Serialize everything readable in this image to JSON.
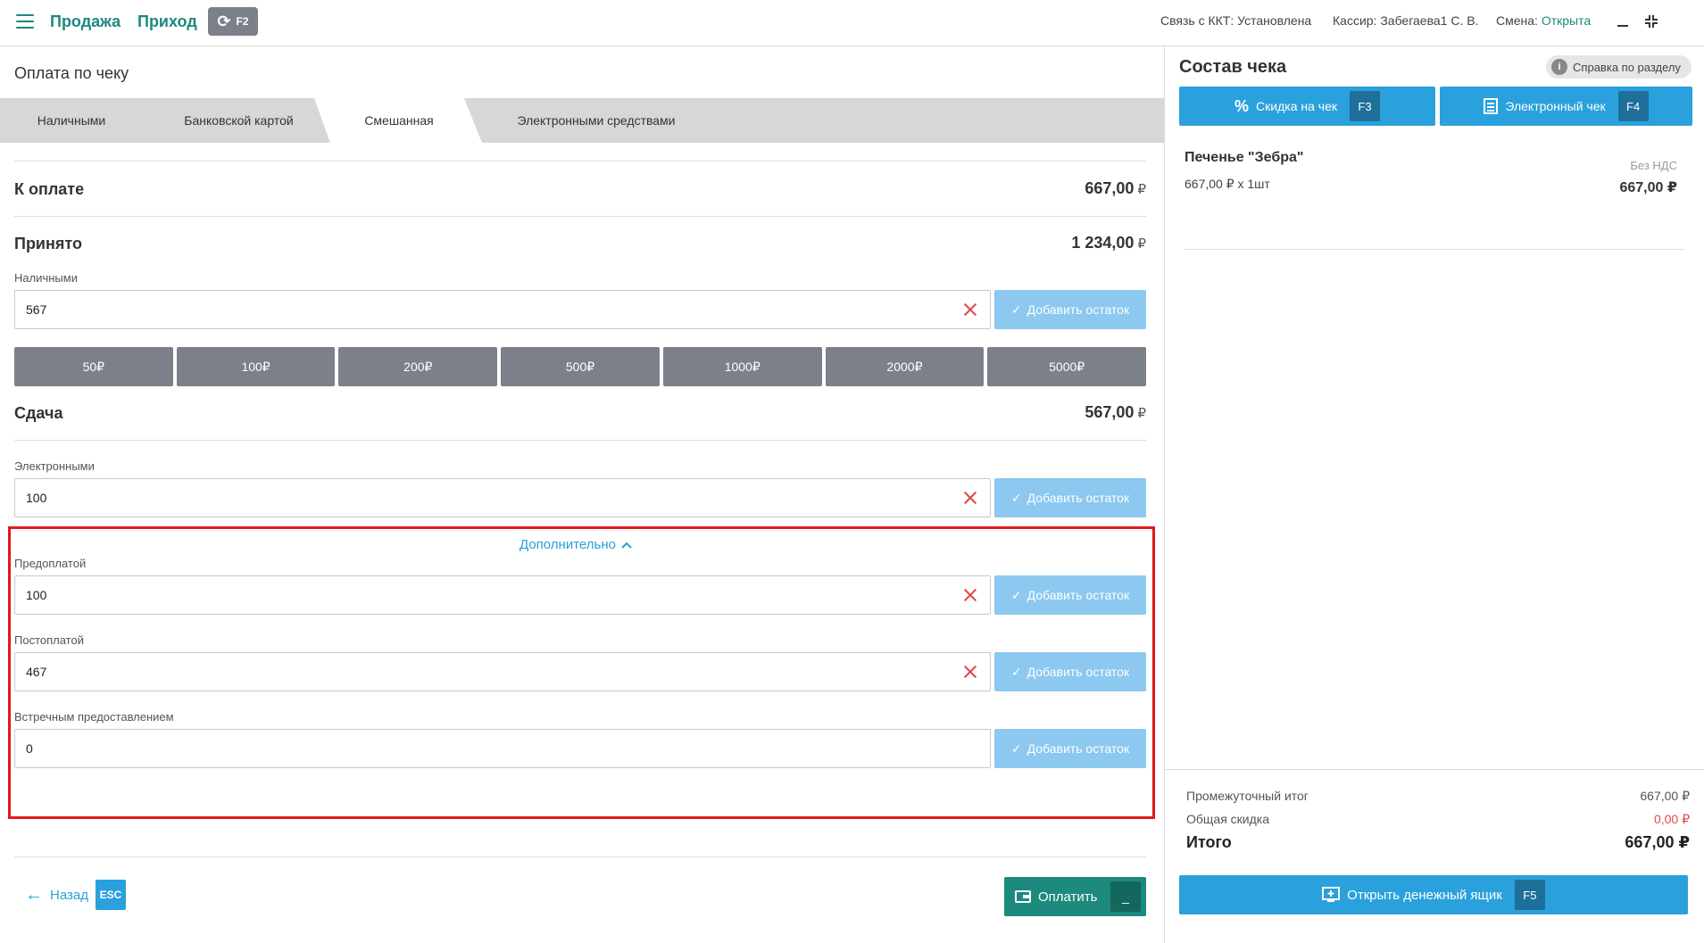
{
  "header": {
    "mode_sale": "Продажа",
    "mode_income": "Приход",
    "sync_key": "F2",
    "kkt_label": "Связь с ККТ: Установлена",
    "cashier_label": "Кассир: Забегаева1 С. В.",
    "shift_label": "Смена:",
    "shift_value": "Открыта"
  },
  "left": {
    "page_title": "Оплата по чеку",
    "tabs": [
      "Наличными",
      "Банковской картой",
      "Смешанная",
      "Электронными средствами"
    ],
    "active_tab": "Смешанная",
    "to_pay_label": "К оплате",
    "to_pay_value": "667,00",
    "received_label": "Принято",
    "received_value": "1 234,00",
    "currency": "₽",
    "cash_label": "Наличными",
    "cash_value": "567",
    "add_rest_label": "Добавить остаток",
    "cash_buttons": [
      "50₽",
      "100₽",
      "200₽",
      "500₽",
      "1000₽",
      "2000₽",
      "5000₽"
    ],
    "change_label": "Сдача",
    "change_value": "567,00",
    "electronic_label": "Электронными",
    "electronic_value": "100",
    "extra_toggle": "Дополнительно",
    "prepaid_label": "Предоплатой",
    "prepaid_value": "100",
    "postpaid_label": "Постоплатой",
    "postpaid_value": "467",
    "counter_label": "Встречным предоставлением",
    "counter_value": "0",
    "back_label": "Назад",
    "back_key": "ESC",
    "pay_label": "Оплатить",
    "pay_key": "_"
  },
  "right": {
    "title": "Состав чека",
    "help_label": "Справка по разделу",
    "discount_label": "Скидка на чек",
    "discount_key": "F3",
    "echeck_label": "Электронный чек",
    "echeck_key": "F4",
    "item": {
      "name": "Печенье \"Зебра\"",
      "qty": "667,00 ₽ x 1шт",
      "vat": "Без НДС",
      "sum": "667,00 ₽"
    },
    "subtotal_label": "Промежуточный итог",
    "subtotal_value": "667,00 ₽",
    "discount_total_label": "Общая скидка",
    "discount_total_value": "0,00 ₽",
    "total_label": "Итого",
    "total_value": "667,00 ₽",
    "drawer_label": "Открыть денежный ящик",
    "drawer_key": "F5"
  },
  "colors": {
    "accent_green": "#1c8a7c",
    "accent_blue": "#2aa1dc",
    "highlight_red": "#e3161e"
  }
}
